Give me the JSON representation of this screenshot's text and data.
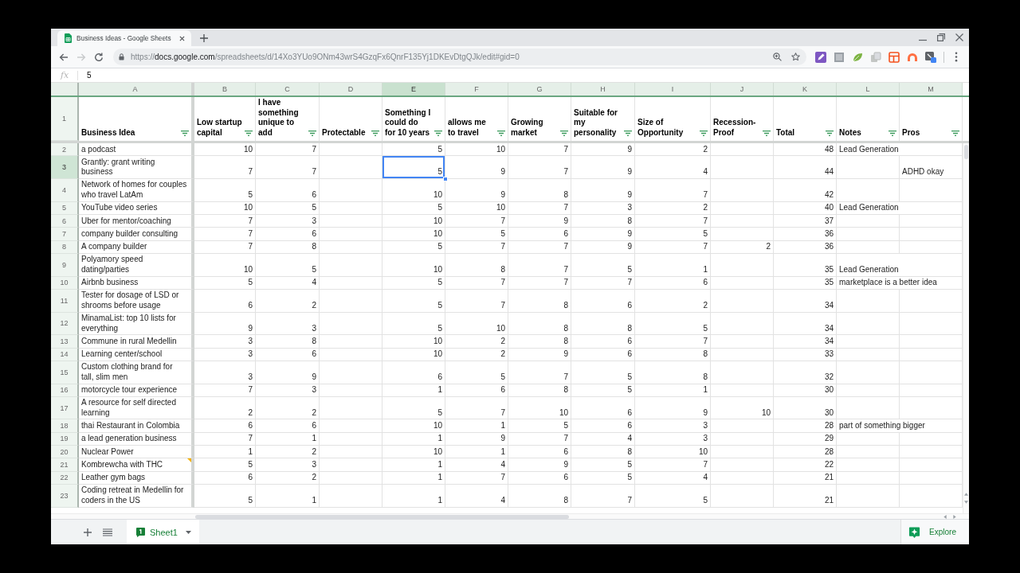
{
  "browser": {
    "tabs": [
      {
        "title": "Business Ideas - Google Sheets",
        "selected": true
      }
    ],
    "nav": [
      {
        "kind": "back",
        "disabled": false
      },
      {
        "kind": "forward",
        "disabled": true
      },
      {
        "kind": "reload",
        "disabled": false
      }
    ],
    "url": {
      "scheme": "https://",
      "host": "docs.google.com",
      "path": "/spreadsheets/d/14Xo3YUo9ONm43wrS4GzqFx6QnrF135Yj1DKEvDtgQJk/edit#gid=0"
    }
  },
  "formula_bar": {
    "label": "fx",
    "value": "5"
  },
  "table": {
    "heading_row": {
      "number": "1",
      "selected": false
    },
    "columns": [
      {
        "letter": "A",
        "heading": "Business Idea",
        "kind": "text",
        "selected": false
      },
      {
        "letter": "B",
        "heading": "Low startup\ncapital",
        "kind": "number",
        "selected": false
      },
      {
        "letter": "C",
        "heading": "I have\nsomething\nunique to\nadd",
        "kind": "number",
        "selected": false
      },
      {
        "letter": "D",
        "heading": "Protectable",
        "kind": "number",
        "selected": false
      },
      {
        "letter": "E",
        "heading": "Something I\ncould do\nfor 10 years",
        "kind": "number",
        "selected": true
      },
      {
        "letter": "F",
        "heading": "allows me\nto travel",
        "kind": "number",
        "selected": false
      },
      {
        "letter": "G",
        "heading": "Growing\nmarket",
        "kind": "number",
        "selected": false
      },
      {
        "letter": "H",
        "heading": "Suitable for\nmy\npersonality",
        "kind": "number",
        "selected": false
      },
      {
        "letter": "I",
        "heading": "Size of\nOpportunity",
        "kind": "number",
        "selected": false
      },
      {
        "letter": "J",
        "heading": "Recession-\nProof",
        "kind": "number",
        "selected": false
      },
      {
        "letter": "K",
        "heading": "Total",
        "kind": "number",
        "selected": false
      },
      {
        "letter": "L",
        "heading": "Notes",
        "kind": "text",
        "selected": false
      },
      {
        "letter": "M",
        "heading": "Pros",
        "kind": "text",
        "selected": false
      }
    ],
    "rows": [
      {
        "number": "2",
        "selected": false,
        "comment": false,
        "cells": [
          "a podcast",
          "10",
          "7",
          null,
          "5",
          "10",
          "7",
          "9",
          "2",
          null,
          "48",
          "Lead Generation",
          null
        ]
      },
      {
        "number": "3",
        "selected": true,
        "comment": false,
        "cells": [
          "Grantly: grant writing\nbusiness",
          "7",
          "7",
          null,
          "5",
          "9",
          "7",
          "9",
          "4",
          null,
          "44",
          null,
          "ADHD okay"
        ]
      },
      {
        "number": "4",
        "selected": false,
        "comment": false,
        "cells": [
          "Network of homes for couples\nwho travel LatAm",
          "5",
          "6",
          null,
          "10",
          "9",
          "8",
          "9",
          "7",
          null,
          "42",
          null,
          null
        ]
      },
      {
        "number": "5",
        "selected": false,
        "comment": false,
        "cells": [
          "YouTube video series",
          "10",
          "5",
          null,
          "5",
          "10",
          "7",
          "3",
          "2",
          null,
          "40",
          "Lead Generation",
          null
        ]
      },
      {
        "number": "6",
        "selected": false,
        "comment": false,
        "cells": [
          "Uber for mentor/coaching",
          "7",
          "3",
          null,
          "10",
          "7",
          "9",
          "8",
          "7",
          null,
          "37",
          null,
          null
        ]
      },
      {
        "number": "7",
        "selected": false,
        "comment": false,
        "cells": [
          "company builder consulting",
          "7",
          "6",
          null,
          "10",
          "5",
          "6",
          "9",
          "5",
          null,
          "36",
          null,
          null
        ]
      },
      {
        "number": "8",
        "selected": false,
        "comment": false,
        "cells": [
          "A company builder",
          "7",
          "8",
          null,
          "5",
          "7",
          "7",
          "9",
          "7",
          "2",
          "36",
          null,
          null
        ]
      },
      {
        "number": "9",
        "selected": false,
        "comment": false,
        "cells": [
          "Polyamory speed\ndating/parties",
          "10",
          "5",
          null,
          "10",
          "8",
          "7",
          "5",
          "1",
          null,
          "35",
          "Lead Generation",
          null
        ]
      },
      {
        "number": "10",
        "selected": false,
        "comment": false,
        "cells": [
          "Airbnb business",
          "5",
          "4",
          null,
          "5",
          "7",
          "7",
          "7",
          "6",
          null,
          "35",
          "marketplace is a better idea",
          null
        ]
      },
      {
        "number": "11",
        "selected": false,
        "comment": false,
        "cells": [
          "Tester for dosage of LSD or\nshrooms before usage",
          "6",
          "2",
          null,
          "5",
          "7",
          "8",
          "6",
          "2",
          null,
          "34",
          null,
          null
        ]
      },
      {
        "number": "12",
        "selected": false,
        "comment": false,
        "cells": [
          "MinamaList: top 10 lists for\neverything",
          "9",
          "3",
          null,
          "5",
          "10",
          "8",
          "8",
          "5",
          null,
          "34",
          null,
          null
        ]
      },
      {
        "number": "13",
        "selected": false,
        "comment": false,
        "cells": [
          "Commune in rural Medellin",
          "3",
          "8",
          null,
          "10",
          "2",
          "8",
          "6",
          "7",
          null,
          "34",
          null,
          null
        ]
      },
      {
        "number": "14",
        "selected": false,
        "comment": false,
        "cells": [
          "Learning center/school",
          "3",
          "6",
          null,
          "10",
          "2",
          "9",
          "6",
          "8",
          null,
          "33",
          null,
          null
        ]
      },
      {
        "number": "15",
        "selected": false,
        "comment": false,
        "cells": [
          "Custom clothing brand for\ntall, slim men",
          "3",
          "9",
          null,
          "6",
          "5",
          "7",
          "5",
          "8",
          null,
          "32",
          null,
          null
        ]
      },
      {
        "number": "16",
        "selected": false,
        "comment": false,
        "cells": [
          "motorcycle tour experience",
          "7",
          "3",
          null,
          "1",
          "6",
          "8",
          "5",
          "1",
          null,
          "30",
          null,
          null
        ]
      },
      {
        "number": "17",
        "selected": false,
        "comment": false,
        "cells": [
          "A resource for self directed\nlearning",
          "2",
          "2",
          null,
          "5",
          "7",
          "10",
          "6",
          "9",
          "10",
          "30",
          null,
          null
        ]
      },
      {
        "number": "18",
        "selected": false,
        "comment": false,
        "cells": [
          "thai Restaurant in Colombia",
          "6",
          "6",
          null,
          "10",
          "1",
          "5",
          "6",
          "3",
          null,
          "28",
          "part of something bigger",
          null
        ]
      },
      {
        "number": "19",
        "selected": false,
        "comment": false,
        "cells": [
          "a lead generation business",
          "7",
          "1",
          null,
          "1",
          "9",
          "7",
          "4",
          "3",
          null,
          "29",
          null,
          null
        ]
      },
      {
        "number": "20",
        "selected": false,
        "comment": false,
        "cells": [
          "Nuclear Power",
          "1",
          "2",
          null,
          "10",
          "1",
          "6",
          "8",
          "10",
          null,
          "28",
          null,
          null
        ]
      },
      {
        "number": "21",
        "selected": false,
        "comment": true,
        "cells": [
          "Kombrewcha with THC",
          "5",
          "3",
          null,
          "1",
          "4",
          "9",
          "5",
          "7",
          null,
          "22",
          null,
          null
        ]
      },
      {
        "number": "22",
        "selected": false,
        "comment": false,
        "cells": [
          "Leather gym bags",
          "6",
          "2",
          null,
          "1",
          "7",
          "6",
          "5",
          "4",
          null,
          "21",
          null,
          null
        ]
      },
      {
        "number": "23",
        "selected": false,
        "comment": false,
        "cells": [
          "Coding retreat in Medellin for\ncoders in the US",
          "5",
          "1",
          null,
          "1",
          "4",
          "8",
          "7",
          "5",
          null,
          "21",
          null,
          null
        ]
      }
    ]
  },
  "sheet_tabs": [
    {
      "name": "Sheet1",
      "selected": true
    }
  ],
  "explore": {
    "label": "Explore"
  }
}
